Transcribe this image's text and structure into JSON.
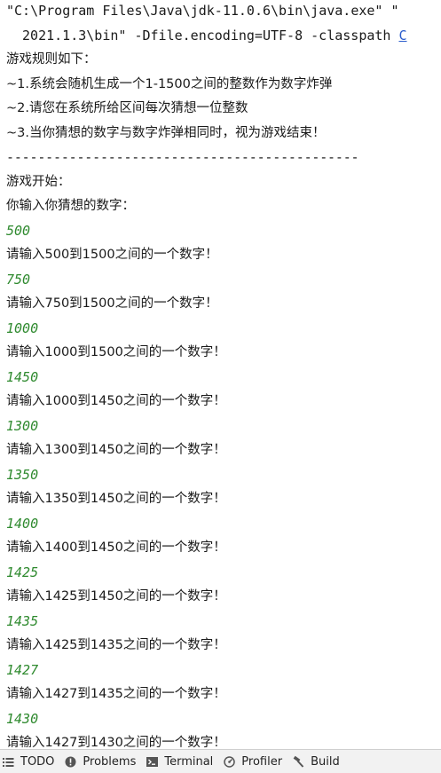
{
  "console": {
    "lines": [
      {
        "text": "\"C:\\Program Files\\Java\\jdk-11.0.6\\bin\\java.exe\" \"",
        "kind": "plain"
      },
      {
        "text": " 2021.1.3\\bin\" -Dfile.encoding=UTF-8 -classpath C",
        "kind": "cmd2"
      },
      {
        "text": "游戏规则如下：",
        "kind": "cjk"
      },
      {
        "text": "~1.系统会随机生成一个1-1500之间的整数作为数字炸弹",
        "kind": "cjk"
      },
      {
        "text": "~2.请您在系统所给区间每次猜想一位整数",
        "kind": "cjk"
      },
      {
        "text": "~3.当你猜想的数字与数字炸弹相同时，视为游戏结束！",
        "kind": "cjk"
      },
      {
        "text": "---------------------------------------------",
        "kind": "sep"
      },
      {
        "text": "游戏开始：",
        "kind": "cjk"
      },
      {
        "text": "你输入你猜想的数字：",
        "kind": "cjk"
      },
      {
        "text": "500",
        "kind": "input"
      },
      {
        "text": "请输入500到1500之间的一个数字！",
        "kind": "cjk"
      },
      {
        "text": "750",
        "kind": "input"
      },
      {
        "text": "请输入750到1500之间的一个数字！",
        "kind": "cjk"
      },
      {
        "text": "1000",
        "kind": "input"
      },
      {
        "text": "请输入1000到1500之间的一个数字！",
        "kind": "cjk"
      },
      {
        "text": "1450",
        "kind": "input"
      },
      {
        "text": "请输入1000到1450之间的一个数字！",
        "kind": "cjk"
      },
      {
        "text": "1300",
        "kind": "input"
      },
      {
        "text": "请输入1300到1450之间的一个数字！",
        "kind": "cjk"
      },
      {
        "text": "1350",
        "kind": "input"
      },
      {
        "text": "请输入1350到1450之间的一个数字！",
        "kind": "cjk"
      },
      {
        "text": "1400",
        "kind": "input"
      },
      {
        "text": "请输入1400到1450之间的一个数字！",
        "kind": "cjk"
      },
      {
        "text": "1425",
        "kind": "input"
      },
      {
        "text": "请输入1425到1450之间的一个数字！",
        "kind": "cjk"
      },
      {
        "text": "1435",
        "kind": "input"
      },
      {
        "text": "请输入1425到1435之间的一个数字！",
        "kind": "cjk"
      },
      {
        "text": "1427",
        "kind": "input"
      },
      {
        "text": "请输入1427到1435之间的一个数字！",
        "kind": "cjk"
      },
      {
        "text": "1430",
        "kind": "input"
      },
      {
        "text": "请输入1427到1430之间的一个数字！",
        "kind": "cjk"
      }
    ]
  },
  "toolbar": {
    "tabs": [
      {
        "label": "TODO",
        "icon": "list-icon"
      },
      {
        "label": "Problems",
        "icon": "problems-icon"
      },
      {
        "label": "Terminal",
        "icon": "terminal-icon"
      },
      {
        "label": "Profiler",
        "icon": "profiler-icon"
      },
      {
        "label": "Build",
        "icon": "hammer-icon"
      }
    ]
  },
  "colors": {
    "user_input": "#2f8a2f",
    "link": "#2a5ccc",
    "text": "#1a1a1a",
    "bar_bg": "#f2f2f2"
  }
}
